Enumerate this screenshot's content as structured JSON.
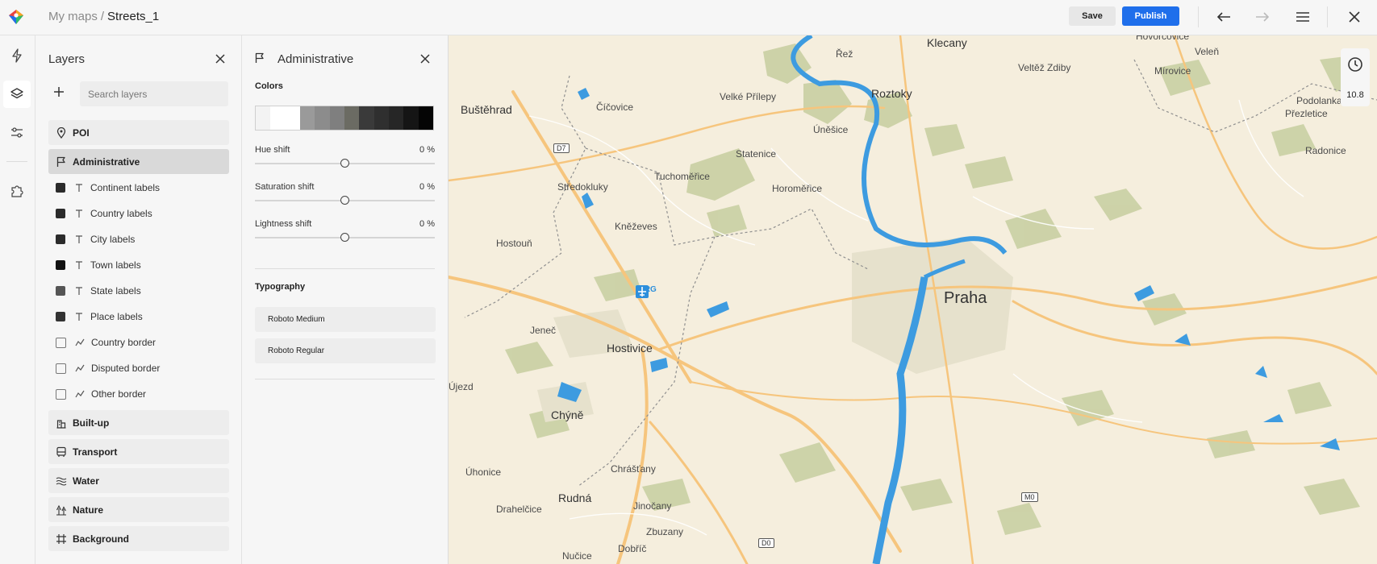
{
  "header": {
    "breadcrumb_parent": "My maps",
    "breadcrumb_sep": "/",
    "breadcrumb_current": "Streets_1",
    "save_label": "Save",
    "publish_label": "Publish",
    "publish_color": "#1f6feb"
  },
  "rail": {
    "icons": [
      "lightning-icon",
      "layers-icon",
      "sliders-icon",
      "puzzle-icon"
    ],
    "active": "layers-icon"
  },
  "layers": {
    "title": "Layers",
    "search_placeholder": "Search layers",
    "groups": [
      {
        "label": "POI",
        "icon": "pin-icon"
      },
      {
        "label": "Administrative",
        "icon": "flag-icon",
        "active": true
      },
      {
        "label": "Built-up",
        "icon": "buildings-icon"
      },
      {
        "label": "Transport",
        "icon": "bus-icon"
      },
      {
        "label": "Water",
        "icon": "waves-icon"
      },
      {
        "label": "Nature",
        "icon": "trees-icon"
      },
      {
        "label": "Background",
        "icon": "frame-icon"
      }
    ],
    "admin_items": [
      {
        "label": "Continent labels",
        "type": "text",
        "checked": true
      },
      {
        "label": "Country labels",
        "type": "text",
        "checked": true
      },
      {
        "label": "City labels",
        "type": "text",
        "checked": true
      },
      {
        "label": "Town labels",
        "type": "text",
        "checked": true
      },
      {
        "label": "State labels",
        "type": "text",
        "checked": true
      },
      {
        "label": "Place labels",
        "type": "text",
        "checked": true
      },
      {
        "label": "Country border",
        "type": "line",
        "checked": false
      },
      {
        "label": "Disputed border",
        "type": "line",
        "checked": false
      },
      {
        "label": "Other border",
        "type": "line",
        "checked": false
      }
    ]
  },
  "props": {
    "title": "Administrative",
    "colors_title": "Colors",
    "swatches": [
      "#f3f3f3",
      "#ffffff",
      "#ffffff",
      "#9a9a9a",
      "#8c8c8c",
      "#7f7f7f",
      "#6b6b63",
      "#3a3a3a",
      "#2f2f2f",
      "#262626",
      "#151515",
      "#050505"
    ],
    "sliders": [
      {
        "label": "Hue shift",
        "value": "0 %",
        "level": 0.5
      },
      {
        "label": "Saturation shift",
        "value": "0 %",
        "level": 0.5
      },
      {
        "label": "Lightness shift",
        "value": "0 %",
        "level": 0.5
      }
    ],
    "typography_title": "Typography",
    "fonts": [
      "Roboto Medium",
      "Roboto Regular"
    ]
  },
  "map": {
    "zoom": "10.8",
    "places": [
      {
        "name": "Klecany",
        "cls": "town"
      },
      {
        "name": "Řež",
        "cls": ""
      },
      {
        "name": "Veltěž Zdiby",
        "cls": ""
      },
      {
        "name": "Hovorčovice",
        "cls": ""
      },
      {
        "name": "Veleň",
        "cls": ""
      },
      {
        "name": "Mírovice",
        "cls": ""
      },
      {
        "name": "Podolanka",
        "cls": ""
      },
      {
        "name": "Přezletice",
        "cls": ""
      },
      {
        "name": "Radonice",
        "cls": ""
      },
      {
        "name": "Roztoky",
        "cls": "town"
      },
      {
        "name": "Velké Přílepy",
        "cls": ""
      },
      {
        "name": "Buštěhrad",
        "cls": "town"
      },
      {
        "name": "Číčovice",
        "cls": ""
      },
      {
        "name": "Úněšice",
        "cls": ""
      },
      {
        "name": "Statenice",
        "cls": ""
      },
      {
        "name": "Tuchoměřice",
        "cls": ""
      },
      {
        "name": "Horoměřice",
        "cls": ""
      },
      {
        "name": "Středokluky",
        "cls": ""
      },
      {
        "name": "Kněževes",
        "cls": ""
      },
      {
        "name": "Hostouň",
        "cls": ""
      },
      {
        "name": "PRG",
        "cls": ""
      },
      {
        "name": "Praha",
        "cls": "city"
      },
      {
        "name": "Jeneč",
        "cls": ""
      },
      {
        "name": "Hostivice",
        "cls": "town"
      },
      {
        "name": "Újezd",
        "cls": ""
      },
      {
        "name": "Chýně",
        "cls": "town"
      },
      {
        "name": "Úhonice",
        "cls": ""
      },
      {
        "name": "Chrášťany",
        "cls": ""
      },
      {
        "name": "Drahelčice",
        "cls": ""
      },
      {
        "name": "Rudná",
        "cls": "town"
      },
      {
        "name": "Jinočany",
        "cls": ""
      },
      {
        "name": "Zbuzany",
        "cls": ""
      },
      {
        "name": "Dobříč",
        "cls": ""
      },
      {
        "name": "Nučice",
        "cls": ""
      }
    ],
    "shields": [
      "D7",
      "D0",
      "M0"
    ],
    "colors": {
      "land": "#f5eedd",
      "forest": "#c9cfa3",
      "water": "#3d9be0",
      "road": "#f6c57d"
    }
  }
}
